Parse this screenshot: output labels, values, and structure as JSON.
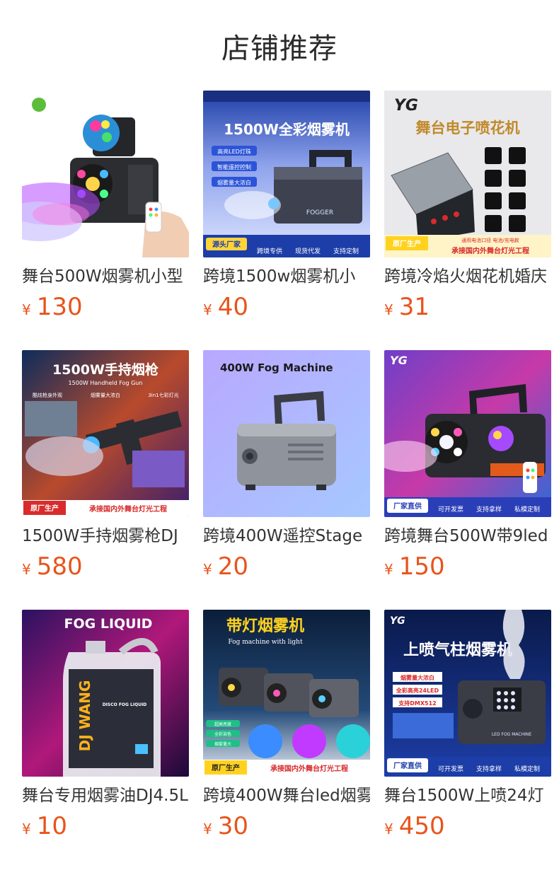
{
  "page_title": "店铺推荐",
  "currency_symbol": "¥",
  "colors": {
    "price": "#e8541c",
    "title": "#2a2a2a",
    "text": "#333333"
  },
  "products": [
    {
      "name": "舞台500W烟雾机小型",
      "price": "130",
      "image_text": [],
      "icon": "fog-machine-disco-ball-image"
    },
    {
      "name": "跨境1500w烟雾机小",
      "price": "40",
      "image_text": [
        "1500W全彩烟雾机",
        "高亮LED灯珠",
        "智能遥控控制",
        "烟雾量大浓白",
        "源头厂家",
        "跨境专供",
        "现货代发",
        "支持定制",
        "FOGGER"
      ],
      "icon": "fog-machine-1500w-image"
    },
    {
      "name": "跨境冷焰火烟花机婚庆",
      "price": "31",
      "image_text": [
        "舞台电子喷花机",
        "原厂生产",
        "通用电池口径 电池/充电款",
        "承接国内外舞台灯光工程"
      ],
      "icon": "cold-spark-machine-image"
    },
    {
      "name": "1500W手持烟雾枪DJ",
      "price": "580",
      "image_text": [
        "1500W手持烟枪",
        "1500W Handheld Fog Gun",
        "酷炫枪身外观",
        "烟雾量大浓白",
        "3in1七彩灯光",
        "原厂生产",
        "承接国内外舞台灯光工程"
      ],
      "icon": "handheld-fog-gun-image"
    },
    {
      "name": "跨境400W遥控Stage",
      "price": "20",
      "image_text": [
        "400W Fog Machine"
      ],
      "icon": "fog-machine-400w-image"
    },
    {
      "name": "跨境舞台500W带9led",
      "price": "150",
      "image_text": [
        "厂家直供",
        "可开发票",
        "支持拿样",
        "私模定制"
      ],
      "icon": "fog-machine-9led-image"
    },
    {
      "name": "舞台专用烟雾油DJ4.5L",
      "price": "10",
      "image_text": [
        "FOG LIQUID",
        "DJ WANG",
        "DISCO FOG LIQUID"
      ],
      "icon": "fog-liquid-image"
    },
    {
      "name": "跨境400W舞台led烟雾机",
      "price": "30",
      "image_text": [
        "带灯烟雾机",
        "Fog machine with light",
        "超高亮度",
        "全彩染色",
        "烟雾量大",
        "原厂生产",
        "承接国内外舞台灯光工程"
      ],
      "icon": "fog-machine-with-light-image"
    },
    {
      "name": "舞台1500W上喷24灯",
      "price": "450",
      "image_text": [
        "上喷气柱烟雾机",
        "烟雾量大浓白",
        "全彩高亮24LED",
        "支持DMX512",
        "LED FOG MACHINE",
        "厂家直供",
        "可开发票",
        "支持拿样",
        "私模定制"
      ],
      "icon": "vertical-fog-machine-image"
    }
  ]
}
